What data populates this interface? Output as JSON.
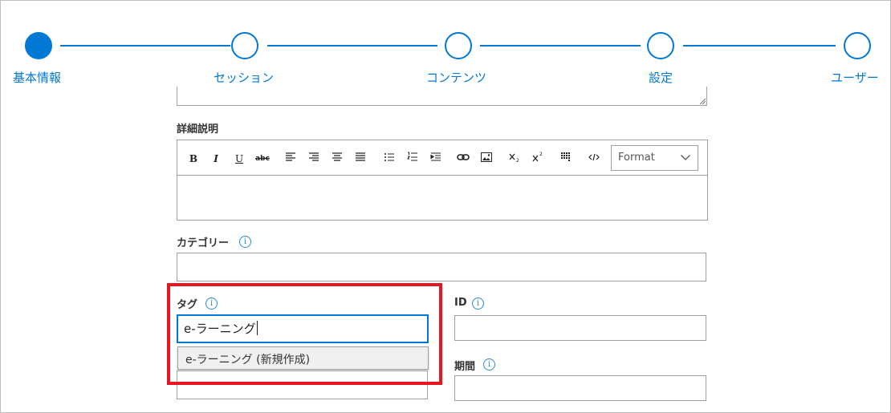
{
  "stepper": {
    "steps": [
      {
        "label": "基本情報",
        "active": true
      },
      {
        "label": "セッション",
        "active": false
      },
      {
        "label": "コンテンツ",
        "active": false
      },
      {
        "label": "設定",
        "active": false
      },
      {
        "label": "ユーザー",
        "active": false
      }
    ],
    "accent_color": "#0078d4"
  },
  "form": {
    "detail": {
      "label": "詳細説明",
      "toolbar": {
        "bold": "B",
        "italic": "I",
        "underline": "U",
        "strike": "abc",
        "format_select": "Format"
      }
    },
    "category": {
      "label": "カテゴリー",
      "value": ""
    },
    "tag": {
      "label": "タグ",
      "value": "e-ラーニング",
      "suggestion": "e-ラーニング (新規作成)"
    },
    "id_field": {
      "label": "ID",
      "value": ""
    },
    "period": {
      "label": "期間",
      "value": ""
    },
    "info_glyph": "i"
  },
  "highlight_color": "#e8171f"
}
